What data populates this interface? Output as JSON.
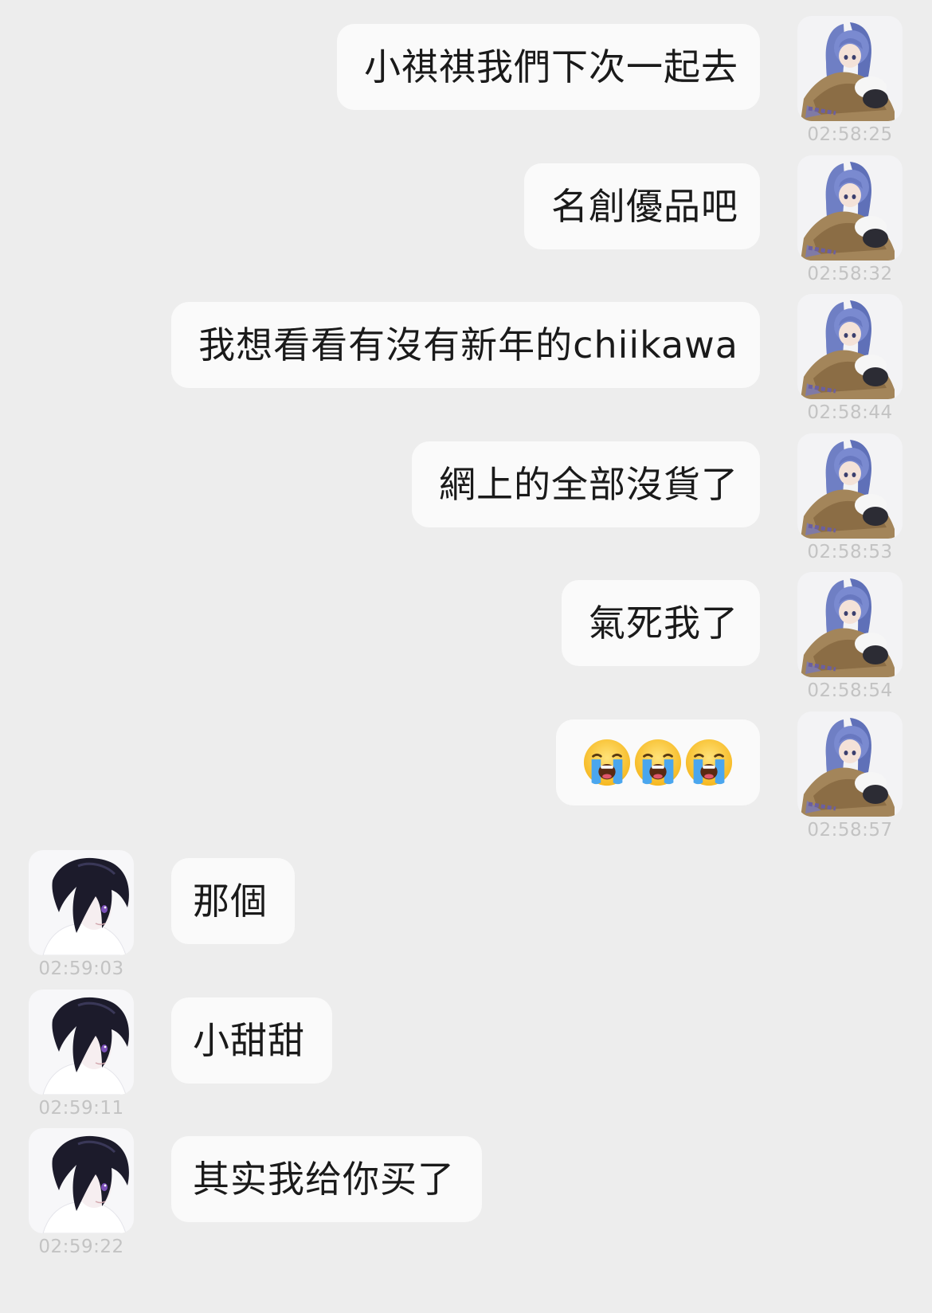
{
  "messages": [
    {
      "side": "out",
      "text": "小祺祺我們下次一起去",
      "time": "02:58:25"
    },
    {
      "side": "out",
      "text": "名創優品吧",
      "time": "02:58:32"
    },
    {
      "side": "out",
      "text": "我想看看有沒有新年的chiikawa",
      "time": "02:58:44"
    },
    {
      "side": "out",
      "text": "網上的全部沒貨了",
      "time": "02:58:53"
    },
    {
      "side": "out",
      "text": "氣死我了",
      "time": "02:58:54"
    },
    {
      "side": "out",
      "emoji": [
        "loudly-crying-face-icon",
        "loudly-crying-face-icon",
        "loudly-crying-face-icon"
      ],
      "time": "02:58:57"
    },
    {
      "side": "in",
      "text": "那個",
      "time": "02:59:03"
    },
    {
      "side": "in",
      "text": "小甜甜",
      "time": "02:59:11"
    },
    {
      "side": "in",
      "text": "其实我给你买了",
      "time": "02:59:22"
    }
  ],
  "avatars": {
    "out": "blue-haired-anime-girl-avatar",
    "in": "dark-haired-anime-boy-avatar"
  },
  "colors": {
    "background": "#ededed",
    "bubble": "#fafafa",
    "text": "#1a1a1a",
    "timestamp": "#c3c3c3"
  }
}
